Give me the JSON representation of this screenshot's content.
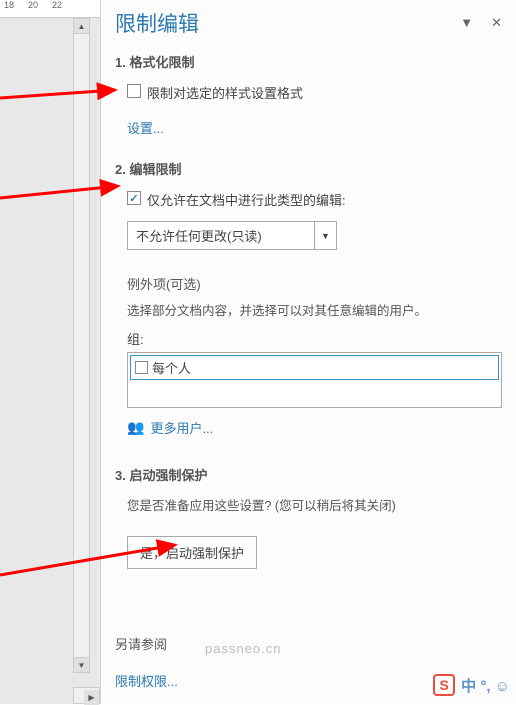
{
  "ruler": {
    "marks": [
      "18",
      "20",
      "22"
    ]
  },
  "panel": {
    "title": "限制编辑",
    "section1": {
      "title": "1. 格式化限制",
      "checkbox_label": "限制对选定的样式设置格式",
      "settings_link": "设置..."
    },
    "section2": {
      "title": "2. 编辑限制",
      "checkbox_label": "仅允许在文档中进行此类型的编辑:",
      "dropdown_value": "不允许任何更改(只读)",
      "exceptions_title": "例外项(可选)",
      "exceptions_desc": "选择部分文档内容，并选择可以对其任意编辑的用户。",
      "group_label": "组:",
      "group_item": "每个人",
      "more_users": "更多用户..."
    },
    "section3": {
      "title": "3. 启动强制保护",
      "desc": "您是否准备应用这些设置? (您可以稍后将其关闭)",
      "button": "是，启动强制保护"
    },
    "footer": {
      "title": "另请参阅",
      "link": "限制权限..."
    }
  },
  "watermark": "passneo.cn",
  "ime": {
    "logo": "S",
    "text": "中 °, ☺"
  }
}
